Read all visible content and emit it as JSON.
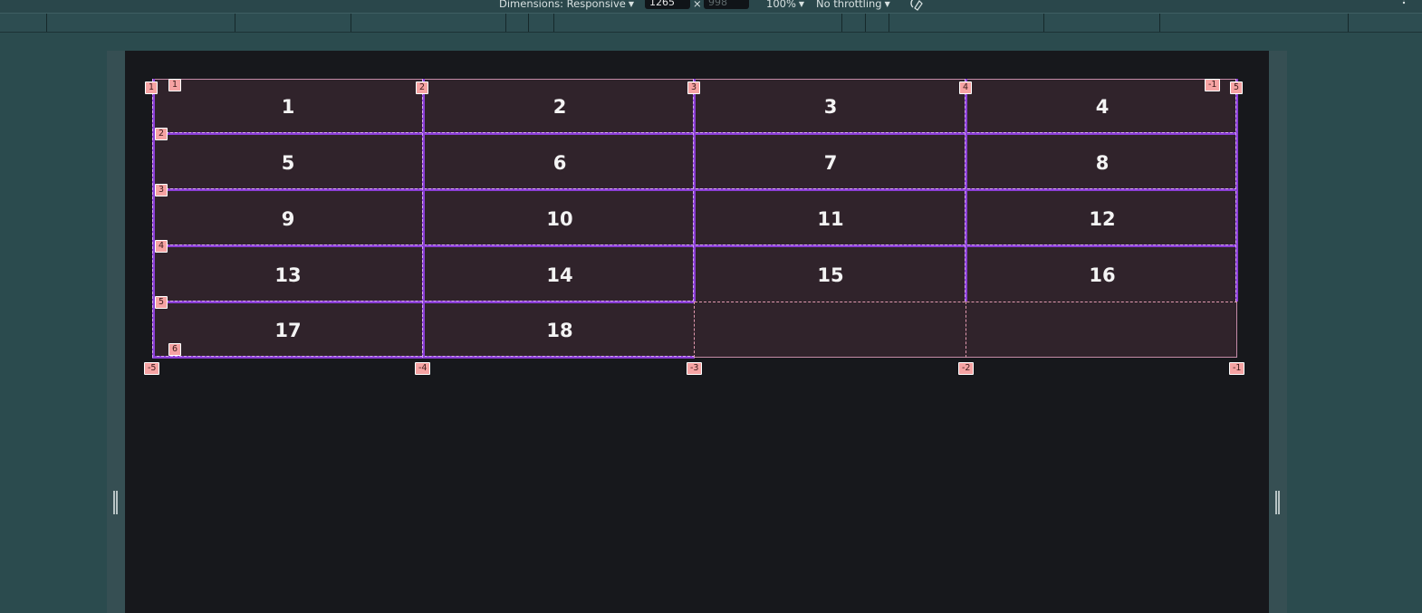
{
  "toolbar": {
    "dimensions_label": "Dimensions: Responsive",
    "width_value": "1265",
    "height_placeholder": "998",
    "times": "×",
    "zoom": "100%",
    "throttling": "No throttling",
    "caret": "▼",
    "rotate_icon": "rotate-icon",
    "more_icon": "more-vertical-icon"
  },
  "grid": {
    "cells": [
      "1",
      "2",
      "3",
      "4",
      "5",
      "6",
      "7",
      "8",
      "9",
      "10",
      "11",
      "12",
      "13",
      "14",
      "15",
      "16",
      "17",
      "18"
    ],
    "column_labels_top": [
      "1",
      "2",
      "3",
      "4",
      "5"
    ],
    "column_labels_bottom": [
      "-5",
      "-4",
      "-3",
      "-2",
      "-1"
    ],
    "row_labels": [
      "1",
      "2",
      "3",
      "4",
      "5",
      "6"
    ],
    "row_label_top_right": "-1"
  },
  "colors": {
    "grid_line": "#8b3fd6",
    "badge": "#f6a3a3",
    "cell_bg": "#30232b",
    "page_bg": "#17181c"
  }
}
